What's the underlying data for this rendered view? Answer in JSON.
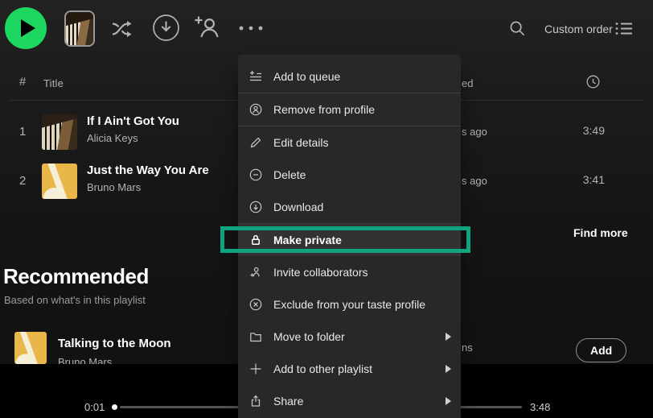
{
  "colors": {
    "accent_green": "#1ed760",
    "highlight_teal": "#10a37f",
    "menu_bg": "#282828",
    "page_bg": "#121212",
    "muted_text": "#b3b3b3"
  },
  "icons": {
    "play-icon": "black right triangle in green circle",
    "shuffle-icon": "crossed arrows",
    "download-circle-icon": "down arrow in circle",
    "add-person-icon": "person silhouette with plus",
    "more-icon": "three dots",
    "search-icon": "magnifier",
    "view-list-icon": "three lines with bullets",
    "clock-icon": "clock face",
    "add-to-queue-icon": "plus with list lines",
    "remove-from-profile-icon": "person in circle",
    "pencil-icon": "pencil",
    "minus-circle-icon": "minus in circle",
    "download-icon": "down arrow in circle",
    "lock-icon": "padlock",
    "person-add-icon": "person with plus",
    "x-circle-icon": "x in circle",
    "folder-icon": "folder outline",
    "plus-icon": "plus",
    "share-icon": "box with up arrow",
    "submenu-arrow-icon": "right-pointing triangle"
  },
  "toolbar": {
    "custom_order_label": "Custom order"
  },
  "table": {
    "header": {
      "number": "#",
      "title": "Title",
      "date_added_fragment": "ed"
    },
    "rows": [
      {
        "number": "1",
        "title": "If I Ain't Got You",
        "artist": "Alicia Keys",
        "added_fragment": "s ago",
        "duration": "3:49"
      },
      {
        "number": "2",
        "title": "Just the Way You Are",
        "artist": "Bruno Mars",
        "added_fragment": "s ago",
        "duration": "3:41"
      }
    ],
    "find_more_label": "Find more"
  },
  "menu": {
    "items": [
      {
        "label": "Add to queue",
        "icon": "add-to-queue-icon"
      },
      {
        "label": "Remove from profile",
        "icon": "remove-from-profile-icon"
      },
      {
        "label": "Edit details",
        "icon": "pencil-icon"
      },
      {
        "label": "Delete",
        "icon": "minus-circle-icon"
      },
      {
        "label": "Download",
        "icon": "download-icon"
      },
      {
        "label": "Make private",
        "icon": "lock-icon",
        "highlighted": true
      },
      {
        "label": "Invite collaborators",
        "icon": "person-add-icon"
      },
      {
        "label": "Exclude from your taste profile",
        "icon": "x-circle-icon"
      },
      {
        "label": "Move to folder",
        "icon": "folder-icon",
        "submenu": true
      },
      {
        "label": "Add to other playlist",
        "icon": "plus-icon",
        "submenu": true
      },
      {
        "label": "Share",
        "icon": "share-icon",
        "submenu": true
      }
    ]
  },
  "recommended": {
    "title": "Recommended",
    "subtitle": "Based on what's in this playlist",
    "row": {
      "title": "Talking to the Moon",
      "artist": "Bruno Mars",
      "album_fragment": "ns",
      "add_label": "Add"
    }
  },
  "player": {
    "current_time": "0:01",
    "total_time": "3:48"
  }
}
